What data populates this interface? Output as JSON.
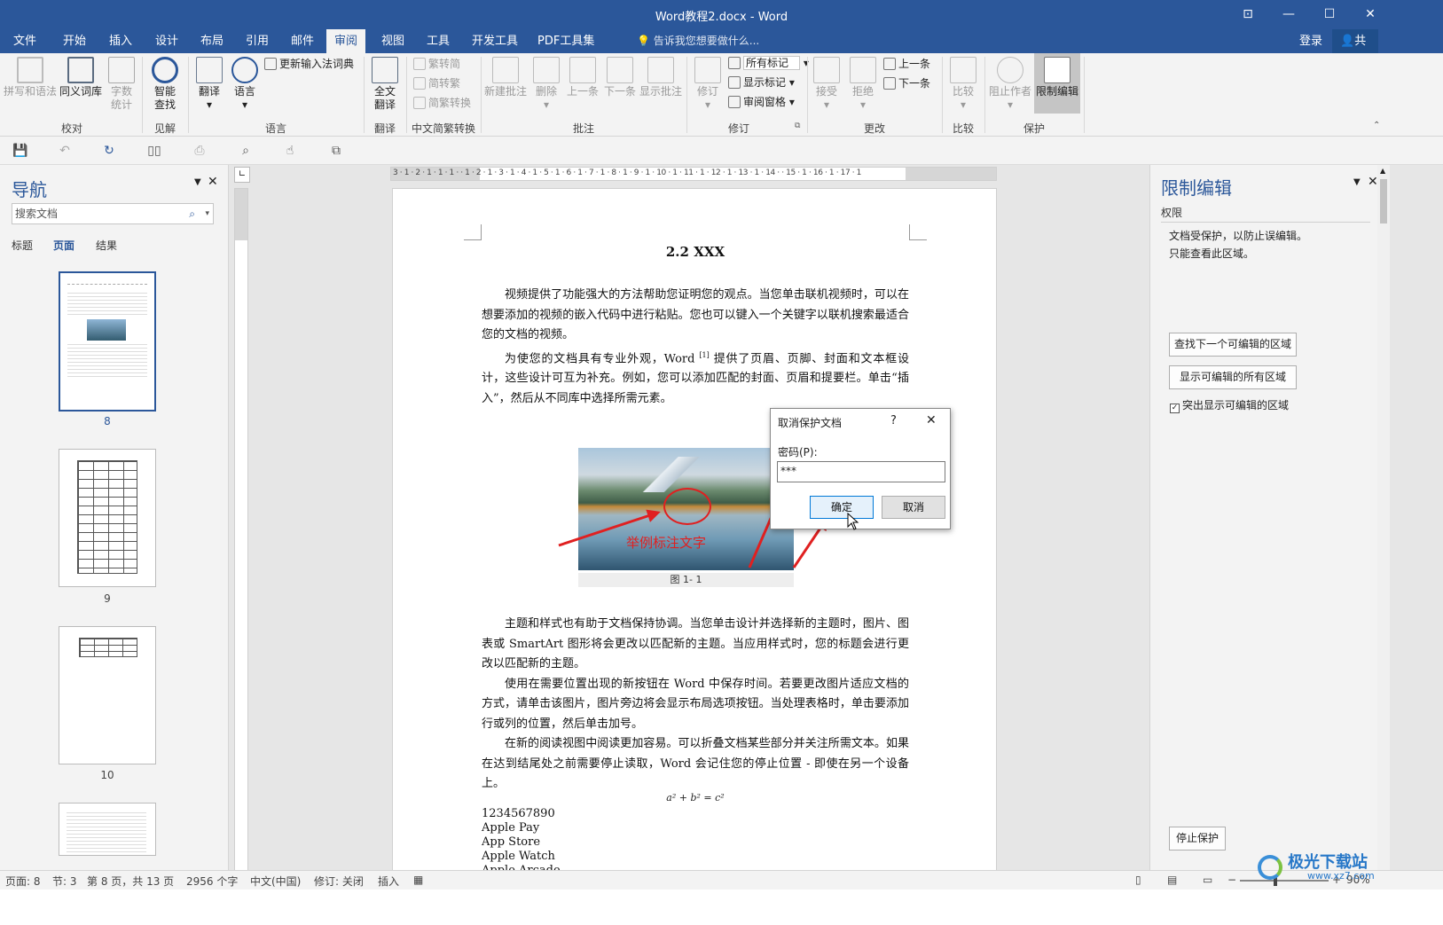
{
  "titlebar": {
    "title": "Word教程2.docx - Word"
  },
  "tabs": [
    "文件",
    "开始",
    "插入",
    "设计",
    "布局",
    "引用",
    "邮件",
    "审阅",
    "视图",
    "工具",
    "开发工具",
    "PDF工具集"
  ],
  "active_tab": "审阅",
  "tellme": "告诉我您想要做什么...",
  "account": {
    "login": "登录",
    "share": "共享"
  },
  "ribbon": {
    "proofing": {
      "spell": "拼写和语法",
      "thesaurus": "同义词库",
      "wordcount1": "字数",
      "wordcount2": "统计",
      "group": "校对"
    },
    "insights": {
      "smart1": "智能",
      "smart2": "查找",
      "group": "见解"
    },
    "language": {
      "translate": "翻译",
      "language": "语言",
      "update_ime": "更新输入法词典",
      "group": "语言"
    },
    "translation": {
      "full1": "全文",
      "full2": "翻译",
      "group": "翻译"
    },
    "chinese": {
      "t2s": "繁转简",
      "s2t": "简转繁",
      "convert": "简繁转换",
      "group": "中文简繁转换"
    },
    "comments": {
      "new": "新建批注",
      "delete": "删除",
      "prev": "上一条",
      "next": "下一条",
      "show": "显示批注",
      "group": "批注"
    },
    "tracking": {
      "track": "修订",
      "all_markup": "所有标记",
      "show_markup": "显示标记",
      "review_pane": "审阅窗格",
      "group": "修订"
    },
    "changes": {
      "accept": "接受",
      "reject": "拒绝",
      "prev": "上一条",
      "next": "下一条",
      "group": "更改"
    },
    "compare": {
      "compare": "比较",
      "group": "比较"
    },
    "protect": {
      "block": "阻止作者",
      "restrict": "限制编辑",
      "group": "保护"
    }
  },
  "nav": {
    "title": "导航",
    "search_placeholder": "搜索文档",
    "tabs": [
      "标题",
      "页面",
      "结果"
    ],
    "pages": [
      "8",
      "9",
      "10"
    ]
  },
  "ruler": {
    "top": "3 · 1 · 2 · 1 · 1 · 1 ·   · 1 · 2 · 1 · 3 · 1 · 4 · 1 · 5 · 1 · 6 · 1 · 7 · 1 · 8 · 1 · 9 · 1 · 10 · 1 · 11 · 1 · 12 · 1 · 13 · 1 · 14 ·   · 15 · 1 · 16 · 1 · 17 · 1"
  },
  "document": {
    "heading": "2.2 XXX",
    "p1": "视频提供了功能强大的方法帮助您证明您的观点。当您单击联机视频时，可以在想要添加的视频的嵌入代码中进行粘贴。您也可以键入一个关键字以联机搜索最适合您的文档的视频。",
    "p2a": "为使您的文档具有专业外观，Word ",
    "p2sup": "[1]",
    "p2b": " 提供了页眉、页脚、封面和文本框设计，这些设计可互为补充。例如，您可以添加匹配的封面、页眉和提要栏。单击“插入”，然后从不同库中选择所需元素。",
    "image_annotation": "举例标注文字",
    "caption": "图 1- 1",
    "p3": "主题和样式也有助于文档保持协调。当您单击设计并选择新的主题时，图片、图表或 SmartArt 图形将会更改以匹配新的主题。当应用样式时，您的标题会进行更改以匹配新的主题。",
    "p4": "使用在需要位置出现的新按钮在 Word 中保存时间。若要更改图片适应文档的方式，请单击该图片，图片旁边将会显示布局选项按钮。当处理表格时，单击要添加行或列的位置，然后单击加号。",
    "p5": "在新的阅读视图中阅读更加容易。可以折叠文档某些部分并关注所需文本。如果在达到结尾处之前需要停止读取，Word 会记住您的停止位置 - 即使在另一个设备上。",
    "formula": "a² + b² = c²",
    "lines": [
      "1234567890",
      "Apple Pay",
      "App Store",
      "Apple Watch",
      "Apple Arcade"
    ]
  },
  "dialog": {
    "title": "取消保护文档",
    "help": "?",
    "close": "✕",
    "label": "密码(P):",
    "value": "***",
    "ok": "确定",
    "cancel": "取消"
  },
  "restrict": {
    "title": "限制编辑",
    "section": "权限",
    "desc1": "文档受保护，以防止误编辑。",
    "desc2": "只能查看此区域。",
    "find_next": "查找下一个可编辑的区域",
    "show_all": "显示可编辑的所有区域",
    "highlight": "突出显示可编辑的区域",
    "stop": "停止保护"
  },
  "status": {
    "page": "页面: 8",
    "section": "节: 3",
    "pageof": "第 8 页，共 13 页",
    "words": "2956 个字",
    "lang": "中文(中国)",
    "track": "修订: 关闭",
    "insert": "插入",
    "zoom": "90%"
  },
  "watermark": "极光下载站",
  "watermark_url": "www.xz7.com",
  "colors": {
    "brand": "#2b579a",
    "annotation": "#e02020"
  }
}
